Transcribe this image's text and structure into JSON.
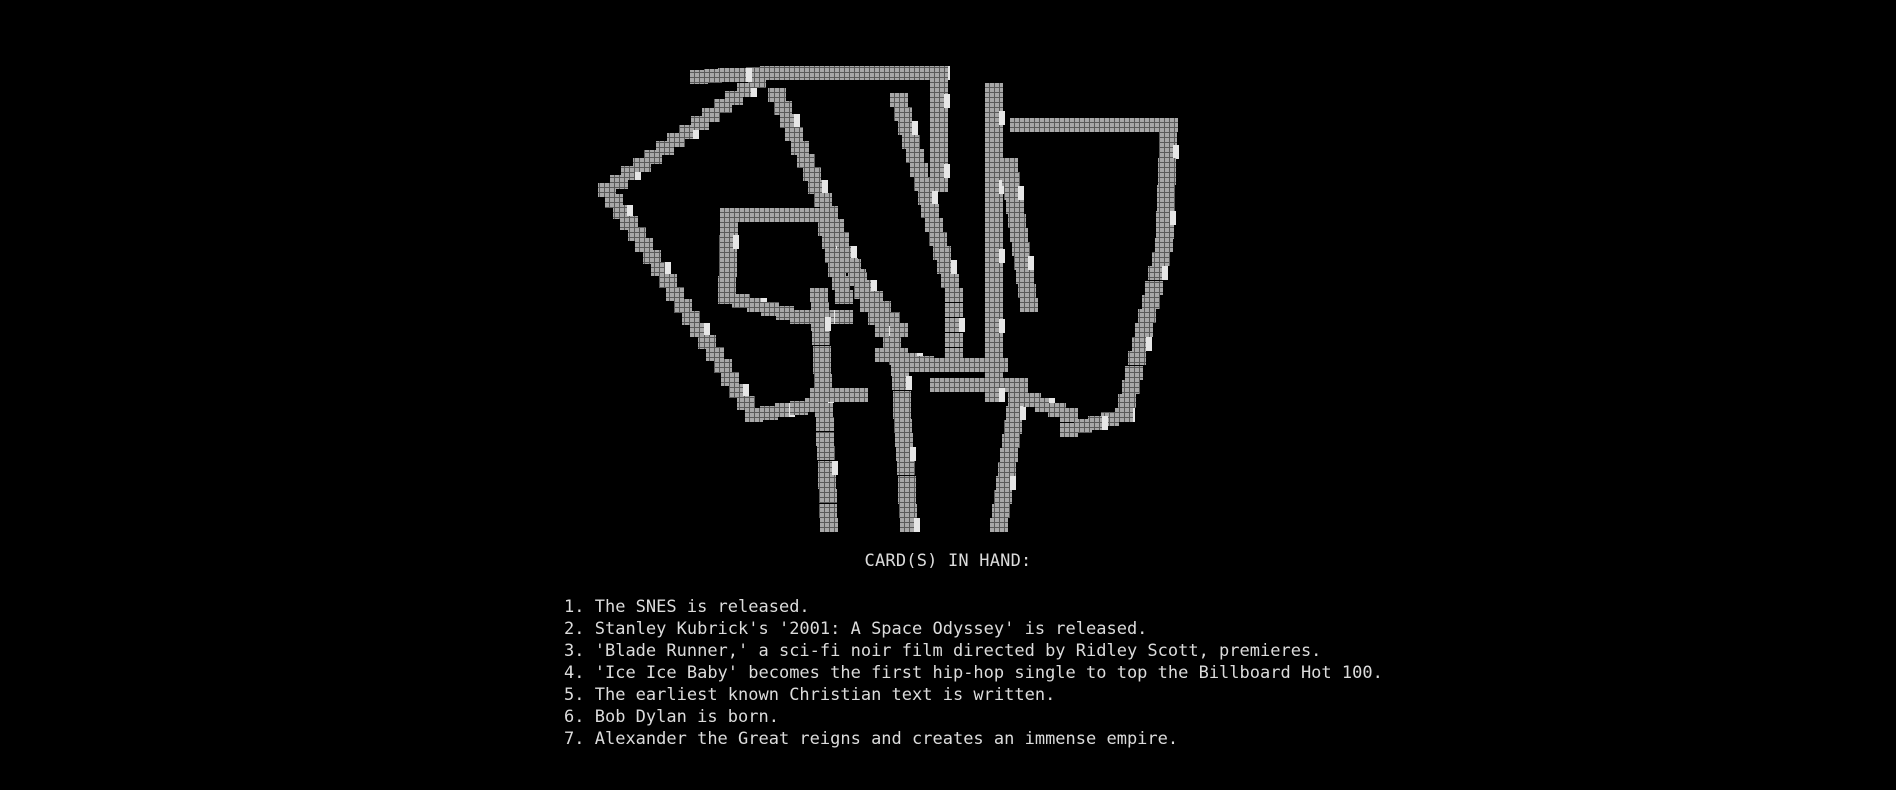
{
  "art": {
    "name": "playing-cards-ascii-art",
    "colors": {
      "block": "#9a9a9a",
      "highlight": "#e6e6e6",
      "background": "#000000"
    }
  },
  "heading": "CARD(S) IN HAND:",
  "cards": [
    {
      "number": "1.",
      "text": "The SNES is released."
    },
    {
      "number": "2.",
      "text": "Stanley Kubrick's '2001: A Space Odyssey' is released."
    },
    {
      "number": "3.",
      "text": "'Blade Runner,' a sci-fi noir film directed by Ridley Scott, premieres."
    },
    {
      "number": "4.",
      "text": "'Ice Ice Baby' becomes the first hip-hop single to top the Billboard Hot 100."
    },
    {
      "number": "5.",
      "text": "The earliest known Christian text is written."
    },
    {
      "number": "6.",
      "text": "Bob Dylan is born."
    },
    {
      "number": "7.",
      "text": "Alexander the Great reigns and creates an immense empire."
    }
  ]
}
